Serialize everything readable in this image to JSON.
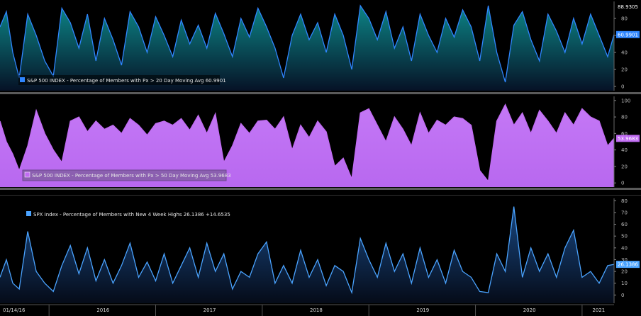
{
  "chart_data": [
    {
      "type": "area",
      "legend": "S&P 500 INDEX - Percentage of Members with Px > 20 Day Moving Avg 60.9901",
      "last_value": "60.9901",
      "max_label": "88.9305",
      "ylim": [
        -5,
        100
      ],
      "yticks": [
        0,
        20,
        40,
        60,
        80
      ],
      "color": "#2f86ff",
      "x": [
        2015.54,
        2015.6,
        2015.66,
        2015.72,
        2015.8,
        2015.88,
        2015.96,
        2016.04,
        2016.12,
        2016.2,
        2016.28,
        2016.36,
        2016.44,
        2016.52,
        2016.6,
        2016.68,
        2016.76,
        2016.84,
        2016.92,
        2017.0,
        2017.08,
        2017.16,
        2017.24,
        2017.32,
        2017.4,
        2017.48,
        2017.56,
        2017.64,
        2017.72,
        2017.8,
        2017.88,
        2017.96,
        2018.04,
        2018.12,
        2018.2,
        2018.28,
        2018.36,
        2018.44,
        2018.52,
        2018.6,
        2018.68,
        2018.76,
        2018.84,
        2018.92,
        2019.0,
        2019.08,
        2019.16,
        2019.24,
        2019.32,
        2019.4,
        2019.48,
        2019.56,
        2019.64,
        2019.72,
        2019.8,
        2019.88,
        2019.96,
        2020.04,
        2020.12,
        2020.2,
        2020.28,
        2020.36,
        2020.44,
        2020.52,
        2020.6,
        2020.68,
        2020.76,
        2020.84,
        2020.92,
        2021.0,
        2021.08,
        2021.16,
        2021.24,
        2021.3
      ],
      "values": [
        70,
        88,
        40,
        10,
        85,
        60,
        30,
        12,
        92,
        75,
        45,
        85,
        30,
        80,
        55,
        25,
        88,
        70,
        40,
        82,
        60,
        35,
        78,
        50,
        72,
        45,
        86,
        62,
        35,
        80,
        58,
        92,
        70,
        45,
        10,
        60,
        85,
        55,
        75,
        40,
        85,
        60,
        20,
        95,
        80,
        55,
        88,
        45,
        70,
        30,
        85,
        60,
        40,
        80,
        58,
        90,
        70,
        30,
        95,
        40,
        5,
        72,
        88,
        55,
        30,
        85,
        65,
        40,
        80,
        50,
        85,
        60,
        35,
        61
      ]
    },
    {
      "type": "area",
      "legend": "S&P 500 INDEX - Percentage of Members with Px > 50 Day Moving Avg 53.9683",
      "last_value": "53.9683",
      "ylim": [
        -5,
        105
      ],
      "yticks": [
        0,
        20,
        40,
        60,
        80,
        100
      ],
      "color": "#c06bf2",
      "x": [
        2015.54,
        2015.6,
        2015.66,
        2015.72,
        2015.8,
        2015.88,
        2015.96,
        2016.04,
        2016.12,
        2016.2,
        2016.28,
        2016.36,
        2016.44,
        2016.52,
        2016.6,
        2016.68,
        2016.76,
        2016.84,
        2016.92,
        2017.0,
        2017.08,
        2017.16,
        2017.24,
        2017.32,
        2017.4,
        2017.48,
        2017.56,
        2017.64,
        2017.72,
        2017.8,
        2017.88,
        2017.96,
        2018.04,
        2018.12,
        2018.2,
        2018.28,
        2018.36,
        2018.44,
        2018.52,
        2018.6,
        2018.68,
        2018.76,
        2018.84,
        2018.92,
        2019.0,
        2019.08,
        2019.16,
        2019.24,
        2019.32,
        2019.4,
        2019.48,
        2019.56,
        2019.64,
        2019.72,
        2019.8,
        2019.88,
        2019.96,
        2020.04,
        2020.12,
        2020.2,
        2020.28,
        2020.36,
        2020.44,
        2020.52,
        2020.6,
        2020.68,
        2020.76,
        2020.84,
        2020.92,
        2021.0,
        2021.08,
        2021.16,
        2021.24,
        2021.3
      ],
      "values": [
        75,
        50,
        35,
        15,
        45,
        88,
        60,
        40,
        25,
        75,
        80,
        62,
        75,
        65,
        70,
        60,
        78,
        70,
        58,
        72,
        75,
        70,
        78,
        64,
        82,
        60,
        84,
        25,
        45,
        72,
        60,
        75,
        76,
        65,
        80,
        40,
        70,
        55,
        75,
        62,
        20,
        30,
        5,
        85,
        90,
        70,
        50,
        80,
        65,
        45,
        85,
        60,
        76,
        70,
        80,
        78,
        70,
        15,
        2,
        75,
        95,
        70,
        85,
        60,
        88,
        75,
        60,
        85,
        70,
        90,
        80,
        75,
        45,
        54
      ]
    },
    {
      "type": "area",
      "legend": "SPX Index - Percentage of Members with New 4 Week Highs 26.1386 +14.6535",
      "last_value": "26.1386",
      "ylim": [
        -7,
        82
      ],
      "yticks": [
        0,
        10,
        20,
        30,
        40,
        50,
        60,
        70,
        80
      ],
      "color": "#4aa3ff",
      "x": [
        2015.54,
        2015.6,
        2015.66,
        2015.72,
        2015.8,
        2015.88,
        2015.96,
        2016.04,
        2016.12,
        2016.2,
        2016.28,
        2016.36,
        2016.44,
        2016.52,
        2016.6,
        2016.68,
        2016.76,
        2016.84,
        2016.92,
        2017.0,
        2017.08,
        2017.16,
        2017.24,
        2017.32,
        2017.4,
        2017.48,
        2017.56,
        2017.64,
        2017.72,
        2017.8,
        2017.88,
        2017.96,
        2018.04,
        2018.12,
        2018.2,
        2018.28,
        2018.36,
        2018.44,
        2018.52,
        2018.6,
        2018.68,
        2018.76,
        2018.84,
        2018.92,
        2019.0,
        2019.08,
        2019.16,
        2019.24,
        2019.32,
        2019.4,
        2019.48,
        2019.56,
        2019.64,
        2019.72,
        2019.8,
        2019.88,
        2019.96,
        2020.04,
        2020.12,
        2020.2,
        2020.28,
        2020.36,
        2020.44,
        2020.52,
        2020.6,
        2020.68,
        2020.76,
        2020.84,
        2020.92,
        2021.0,
        2021.08,
        2021.16,
        2021.24,
        2021.3
      ],
      "values": [
        15,
        30,
        10,
        5,
        54,
        20,
        10,
        3,
        25,
        42,
        18,
        40,
        12,
        30,
        10,
        25,
        44,
        15,
        28,
        12,
        35,
        10,
        25,
        40,
        15,
        44,
        20,
        35,
        5,
        20,
        15,
        35,
        45,
        10,
        25,
        10,
        38,
        15,
        30,
        8,
        25,
        20,
        2,
        48,
        30,
        15,
        44,
        20,
        35,
        10,
        40,
        15,
        30,
        10,
        38,
        20,
        15,
        3,
        2,
        35,
        20,
        75,
        15,
        40,
        20,
        35,
        15,
        40,
        55,
        15,
        20,
        10,
        25,
        26
      ]
    }
  ],
  "x_axis": {
    "start_label": "01/14/16",
    "year_labels": [
      "2016",
      "2017",
      "2018",
      "2019",
      "2020",
      "2021"
    ],
    "year_values": [
      2016.0,
      2017.0,
      2018.0,
      2019.0,
      2020.0,
      2021.0
    ]
  }
}
